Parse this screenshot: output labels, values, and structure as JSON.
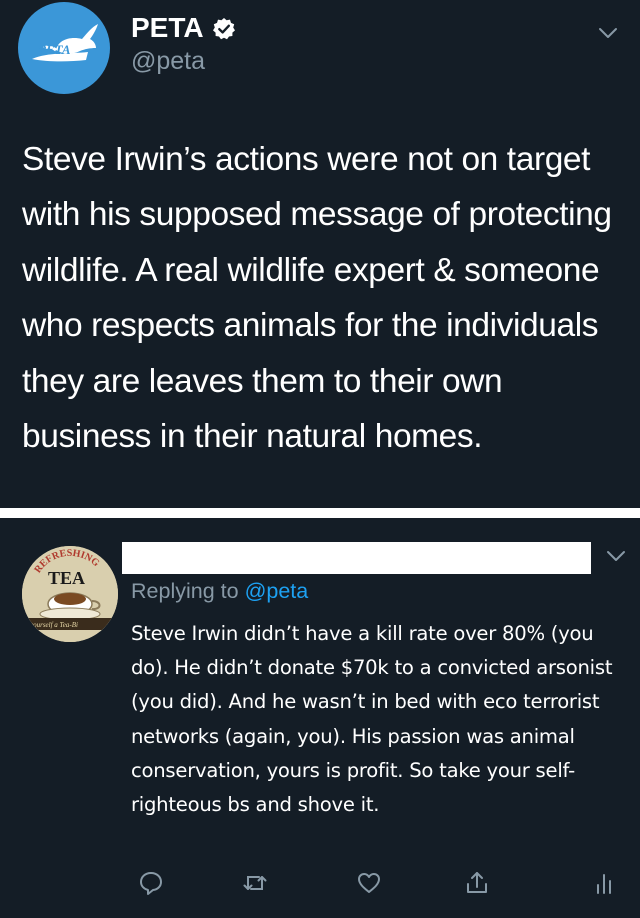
{
  "top_tweet": {
    "display_name": "PETA",
    "handle": "@peta",
    "avatar_text": "PETA",
    "text": "Steve Irwin’s actions were not on target with his supposed message of protecting wildlife. A real wildlife expert & someone who respects animals for the individuals they are leaves them to their own business in their natural homes.",
    "icons": [
      "verified-badge-icon",
      "chevron-down-icon"
    ]
  },
  "reply_tweet": {
    "avatar_text": {
      "top": "REFRESHING",
      "main": "TEA",
      "banner": "yourself a Tea-Bi"
    },
    "replying_to_prefix": "Replying to",
    "replying_to_mention": "@peta",
    "text": "Steve Irwin didn’t have a kill rate over 80% (you do). He didn’t donate $70k to a convicted arsonist (you did). And he wasn’t in bed with eco terrorist networks (again, you). His passion was animal conservation, yours is profit. So take your self-righteous bs and shove it.",
    "actions": [
      "reply-icon",
      "retweet-icon",
      "like-icon",
      "share-icon",
      "analytics-icon"
    ]
  },
  "colors": {
    "background": "#141d26",
    "separator": "#ffffff",
    "text_primary": "#ffffff",
    "text_secondary": "#8899a6",
    "link": "#1da1f2",
    "peta_blue": "#3b97d8"
  }
}
